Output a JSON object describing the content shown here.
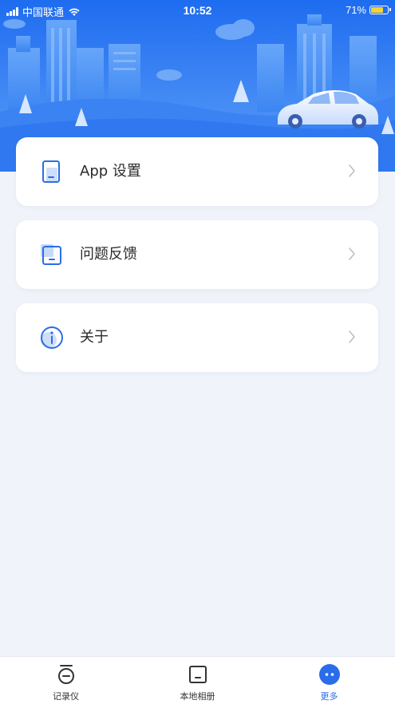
{
  "status_bar": {
    "carrier": "中国联通",
    "time": "10:52",
    "battery": "71%"
  },
  "menu": {
    "items": [
      {
        "label": "App 设置",
        "icon": "phone-settings-icon"
      },
      {
        "label": "问题反馈",
        "icon": "feedback-icon"
      },
      {
        "label": "关于",
        "icon": "info-icon"
      }
    ]
  },
  "tabs": [
    {
      "label": "记录仪",
      "icon": "camera-recorder-icon",
      "active": false
    },
    {
      "label": "本地相册",
      "icon": "album-icon",
      "active": false
    },
    {
      "label": "更多",
      "icon": "more-icon",
      "active": true
    }
  ],
  "colors": {
    "accent": "#2a6de8",
    "header_top": "#1f6ff0",
    "header_bottom": "#3f8bf6",
    "background": "#f0f3f9"
  }
}
